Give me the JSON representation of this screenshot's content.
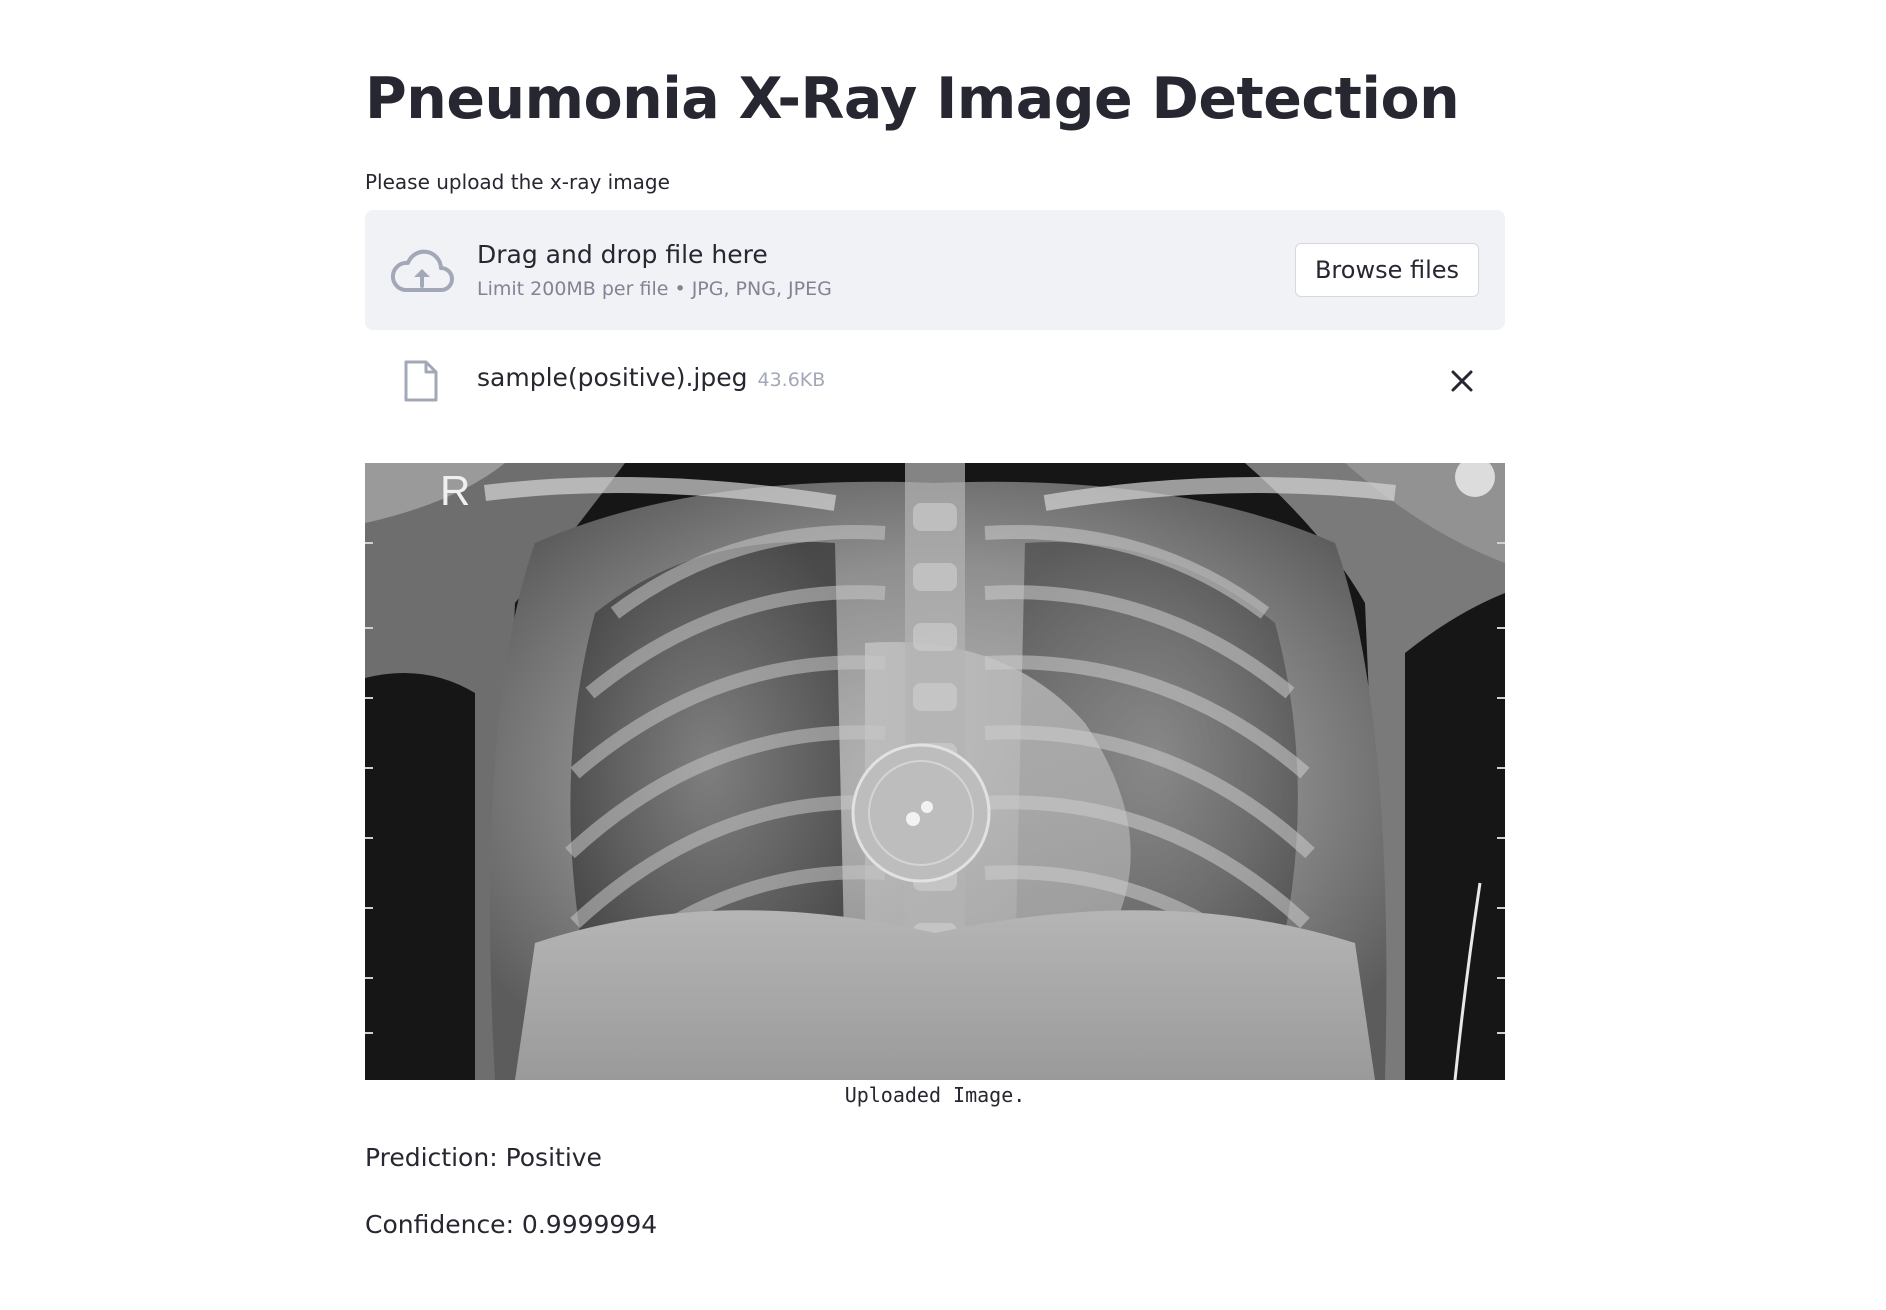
{
  "page": {
    "title": "Pneumonia X-Ray Image Detection"
  },
  "uploader": {
    "label": "Please upload the x-ray image",
    "drop_title": "Drag and drop file here",
    "drop_subtitle": "Limit 200MB per file • JPG, PNG, JPEG",
    "browse_label": "Browse files",
    "icons": {
      "dropzone": "cloud-upload-icon",
      "file": "file-icon",
      "remove": "close-icon"
    }
  },
  "uploaded_file": {
    "name": "sample(positive).jpeg",
    "size": "43.6KB"
  },
  "image": {
    "marker": "R",
    "caption": "Uploaded Image."
  },
  "result": {
    "prediction": "Prediction: Positive",
    "confidence": "Confidence: 0.9999994"
  },
  "colors": {
    "text": "#262730",
    "muted": "#808495",
    "dropzone_bg": "#f0f2f6",
    "background": "#ffffff"
  }
}
